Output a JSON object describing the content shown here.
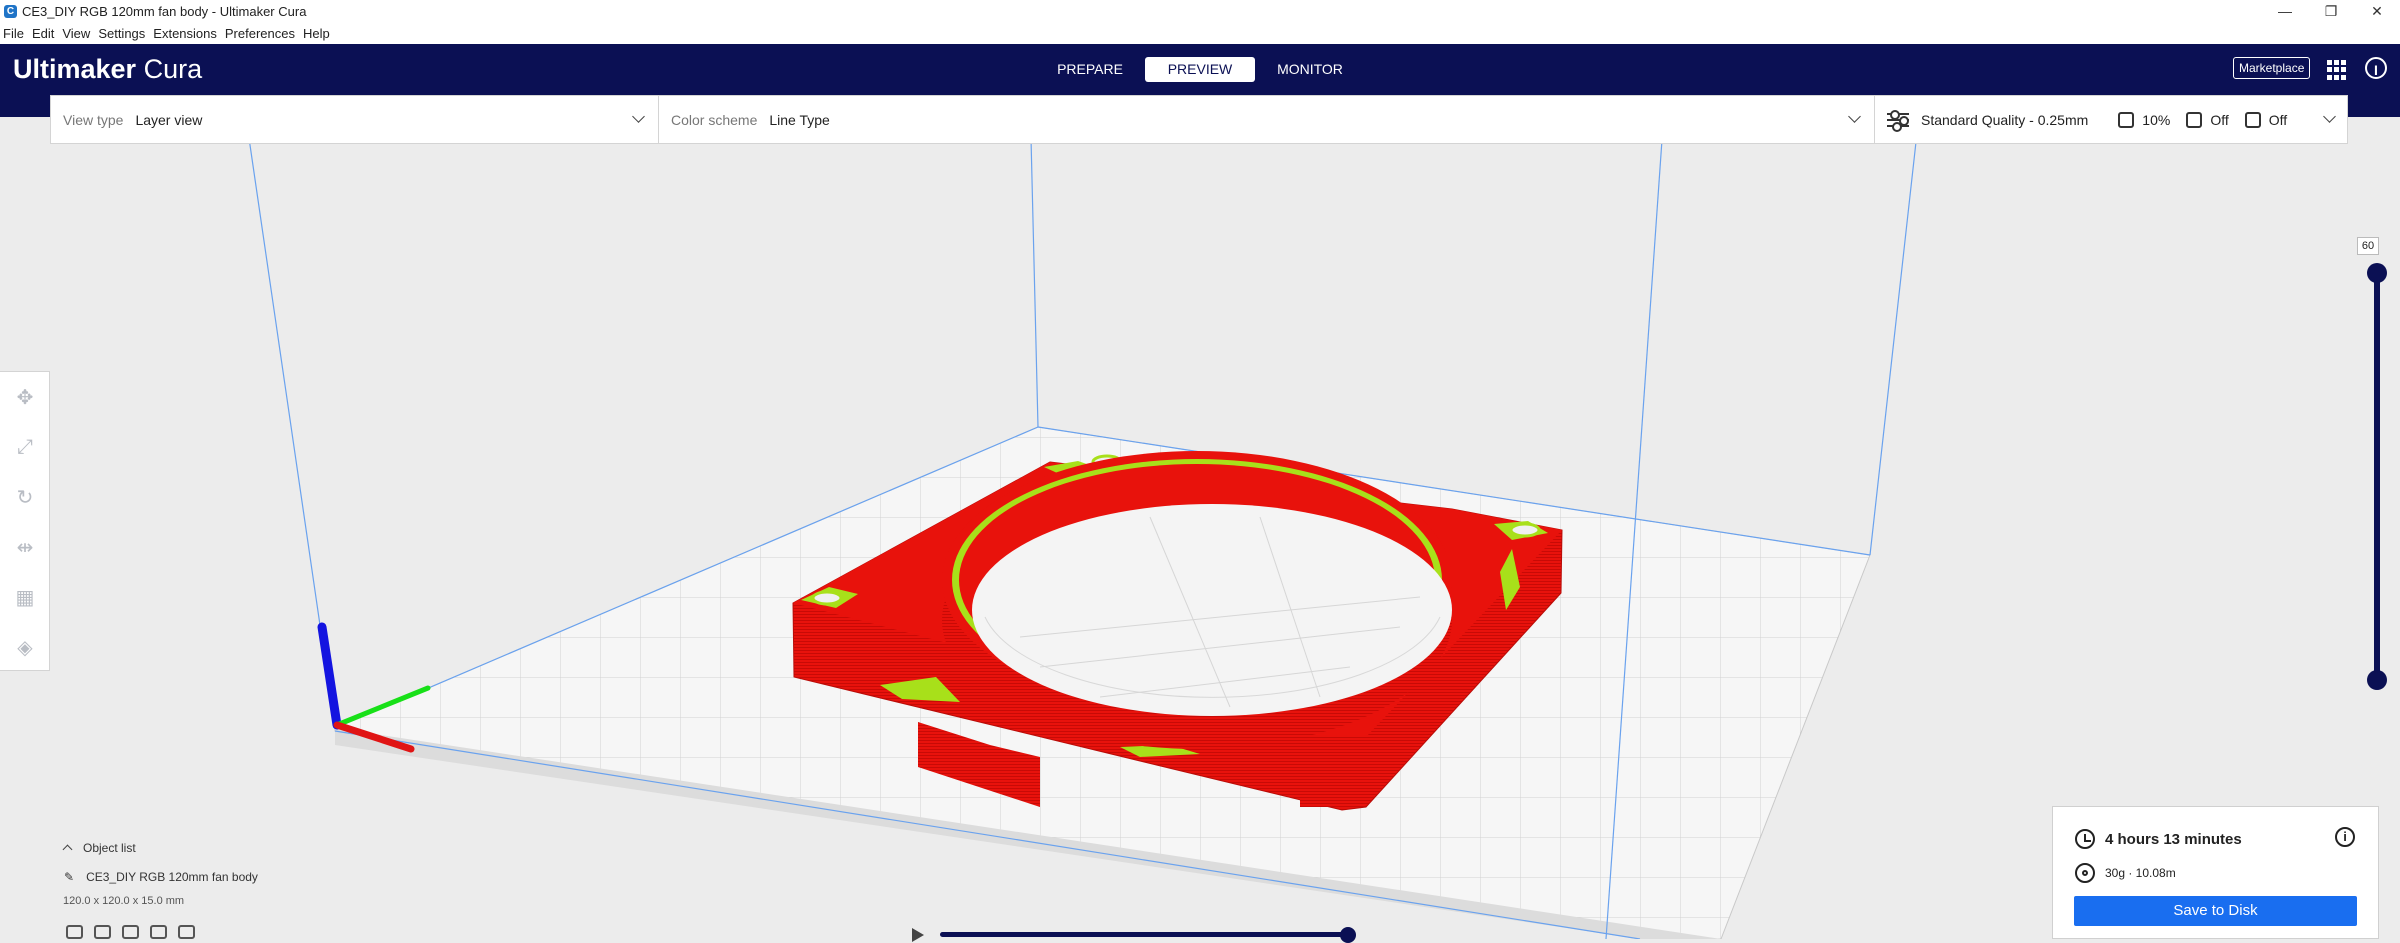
{
  "window": {
    "title": "CE3_DIY RGB 120mm fan body - Ultimaker Cura",
    "controls": [
      "—",
      "❐",
      "✕"
    ]
  },
  "menu": [
    "File",
    "Edit",
    "View",
    "Settings",
    "Extensions",
    "Preferences",
    "Help"
  ],
  "header": {
    "logo_brand": "Ultimaker",
    "logo_product": " Cura",
    "stages": [
      "PREPARE",
      "PREVIEW",
      "MONITOR"
    ],
    "active_stage": "PREVIEW",
    "marketplace_label": "Marketplace",
    "account_glyph": "I"
  },
  "toolbar": {
    "view_type_label": "View type",
    "view_type_value": "Layer view",
    "color_scheme_label": "Color scheme",
    "color_scheme_value": "Line Type",
    "profile": "Standard Quality - 0.25mm",
    "infill": "10%",
    "support": "Off",
    "adhesion": "Off"
  },
  "layer_slider": {
    "max_layer": "60",
    "current_layer": 60
  },
  "object_list": {
    "title": "Object list",
    "object_name": "CE3_DIY RGB 120mm fan body",
    "dimensions": "120.0 x 120.0 x 15.0 mm"
  },
  "print_info": {
    "time": "4 hours 13 minutes",
    "material": "30g · 10.08m",
    "save_label": "Save to Disk",
    "info_glyph": "i"
  },
  "colors": {
    "header_bg": "#0b1054",
    "accent_blue": "#196ef0",
    "wall_red": "#e8120c",
    "infill_green": "#a8e01a"
  },
  "icons": {
    "tools": [
      "move-icon",
      "scale-icon",
      "rotate-icon",
      "mirror-icon",
      "per-model-settings-icon",
      "support-blocker-icon"
    ]
  }
}
